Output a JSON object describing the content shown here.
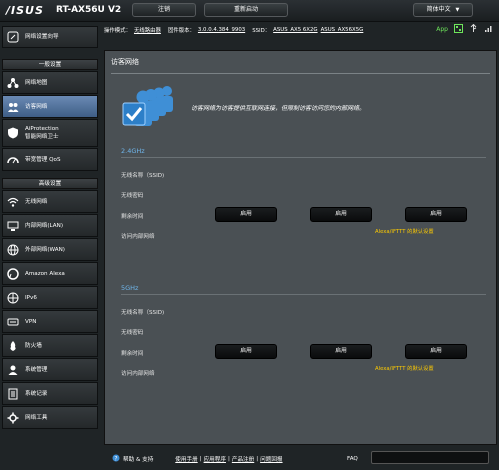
{
  "header": {
    "logo": "/ISUS",
    "model": "RT-AX56U V2",
    "logout": "注销",
    "reboot": "重新启动",
    "language": "简体中文"
  },
  "status": {
    "op_mode_label": "操作模式：",
    "op_mode_value": "无线路由器",
    "firmware_label": "固件版本：",
    "firmware_value": "3.0.0.4.384_9903",
    "ssid_label": "SSID：",
    "ssid_1": "ASUS_AX5 6X2G",
    "ssid_2": "ASUS_AX56X5G",
    "app_label": "App"
  },
  "sidebar": {
    "quick_setup": "网络设置向导",
    "general_header": "一般设置",
    "general_items": [
      {
        "label": "网络地图"
      },
      {
        "label": "访客网络"
      },
      {
        "label": "AiProtection",
        "sub": "智能网络卫士"
      },
      {
        "label": "带宽管理 QoS"
      }
    ],
    "advanced_header": "高级设置",
    "advanced_items": [
      {
        "label": "无线网络"
      },
      {
        "label": "内部网络(LAN)"
      },
      {
        "label": "外部网络(WAN)"
      },
      {
        "label": "Amazon Alexa"
      },
      {
        "label": "IPv6"
      },
      {
        "label": "VPN"
      },
      {
        "label": "防火墙"
      },
      {
        "label": "系统管理"
      },
      {
        "label": "系统记录"
      },
      {
        "label": "网络工具"
      }
    ]
  },
  "main": {
    "title": "访客网络",
    "description": "访客网络为访客提供互联网连接，但限制访客访问您的内部网络。",
    "bands": [
      {
        "name": "2.4GHz",
        "rows": [
          "无线名称（SSID)",
          "无线密码",
          "剩余时间",
          "访问内部网络"
        ],
        "buttons": [
          "启用",
          "启用",
          "启用"
        ],
        "note": "Alexa/IFTTT 的默认设置"
      },
      {
        "name": "5GHz",
        "rows": [
          "无线名称（SSID)",
          "无线密码",
          "剩余时间",
          "访问内部网络"
        ],
        "buttons": [
          "启用",
          "启用",
          "启用"
        ],
        "note": "Alexa/IFTTT 的默认设置"
      }
    ]
  },
  "footer": {
    "help": "帮助 & 支持",
    "manual": "使用手册",
    "utility": "应用程序",
    "register": "产品注册",
    "feedback": "问题回报",
    "faq": "FAQ"
  },
  "colors": {
    "accent_blue": "#6fb6ec",
    "active_item": "#5a7aa6",
    "note_yellow": "#ffcc00",
    "app_green": "#6ee65b"
  }
}
